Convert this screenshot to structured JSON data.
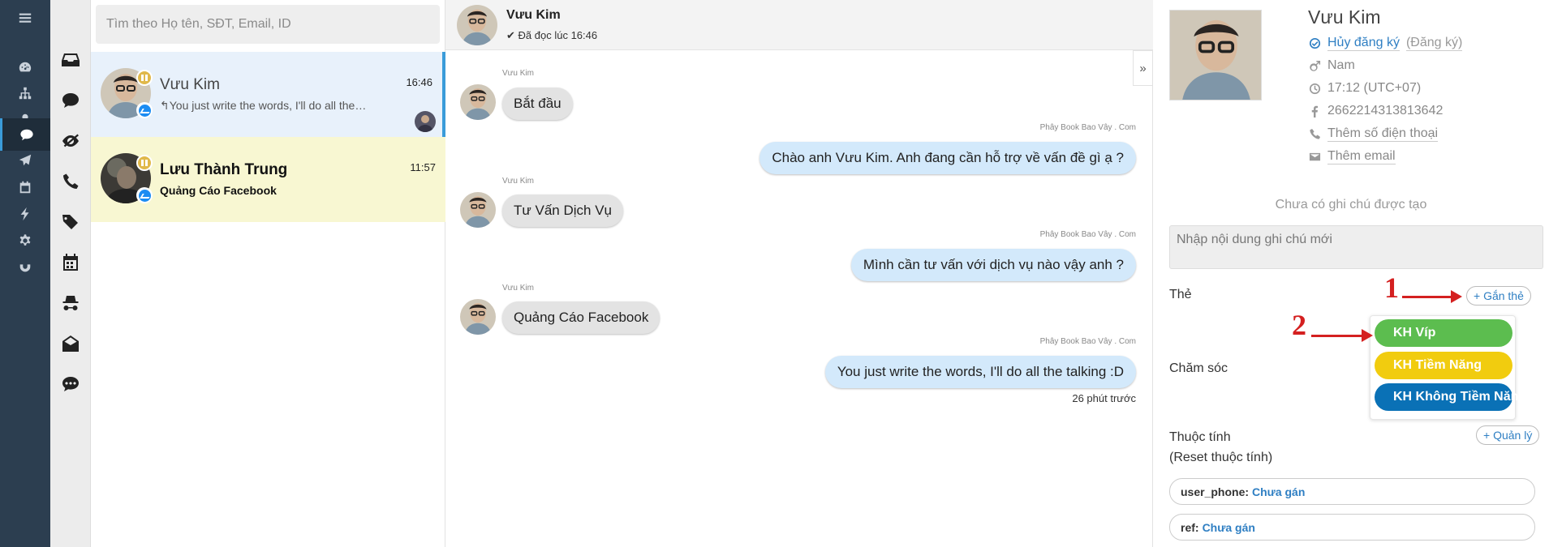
{
  "search": {
    "placeholder": "Tìm theo Họ tên, SĐT, Email, ID"
  },
  "nav": {
    "items": [
      {
        "icon": "dashboard-icon"
      },
      {
        "icon": "sitemap-icon"
      },
      {
        "icon": "user-icon"
      },
      {
        "icon": "chat-icon",
        "active": true
      },
      {
        "icon": "send-icon"
      },
      {
        "icon": "calendar-icon"
      },
      {
        "icon": "bolt-icon"
      },
      {
        "icon": "gear-icon"
      },
      {
        "icon": "magnet-icon"
      }
    ]
  },
  "conversations": [
    {
      "name": "Vưu Kim",
      "time": "16:46",
      "snippet": "You just write the words, I'll do all the…",
      "selected": true
    },
    {
      "name": "Lưu Thành Trung",
      "time": "11:57",
      "snippet": "Quảng Cáo Facebook",
      "unread": true
    }
  ],
  "chat": {
    "name": "Vưu Kim",
    "read_status": "Đã đọc lúc 16:46",
    "messages": [
      {
        "from": "in",
        "sender": "Vưu Kim",
        "text": "Bắt đầu"
      },
      {
        "from": "out",
        "sender": "Phây Book Bao Vây . Com",
        "text": "Chào anh Vưu Kim. Anh đang cần hỗ trợ về vấn đề gì ạ ?"
      },
      {
        "from": "in",
        "sender": "Vưu Kim",
        "text": "Tư Vấn Dịch Vụ"
      },
      {
        "from": "out",
        "sender": "Phây Book Bao Vây . Com",
        "text": "Mình cần tư vấn với dịch vụ nào vậy anh ?"
      },
      {
        "from": "in",
        "sender": "Vưu Kim",
        "text": "Quảng Cáo Facebook"
      },
      {
        "from": "out",
        "sender": "Phây Book Bao Vây . Com",
        "text": "You just write the words, I'll do all the talking :D"
      }
    ],
    "time_ago": "26 phút trước",
    "facebook_label": "f",
    "collapse_label": "»"
  },
  "profile": {
    "name": "Vưu Kim",
    "unsubscribe": "Hủy đăng ký",
    "subscribe": "(Đăng ký)",
    "gender": "Nam",
    "time": "17:12 (UTC+07)",
    "fb_id": "2662214313813642",
    "add_phone": "Thêm số điện thoại",
    "add_email": "Thêm email",
    "note_empty": "Chưa có ghi chú được tạo",
    "note_placeholder": "Nhập nội dung ghi chú mới",
    "tags_label": "Thẻ",
    "add_tag": "+ Gắn thẻ",
    "care_label": "Chăm sóc",
    "tag_options": [
      "KH Víp",
      "KH Tiềm Năng",
      "KH Không Tiềm Năng"
    ],
    "tag_colors": [
      "#5cbd4f",
      "#f1cc0f",
      "#0a71b6"
    ],
    "attributes_label": "Thuộc tính",
    "reset_attributes": "(Reset thuộc tính)",
    "manage": "+ Quản lý",
    "attributes": [
      {
        "key": "user_phone:",
        "value": "Chưa gán"
      },
      {
        "key": "ref:",
        "value": "Chưa gán"
      }
    ]
  },
  "annotations": {
    "step1": "1",
    "step2": "2"
  }
}
